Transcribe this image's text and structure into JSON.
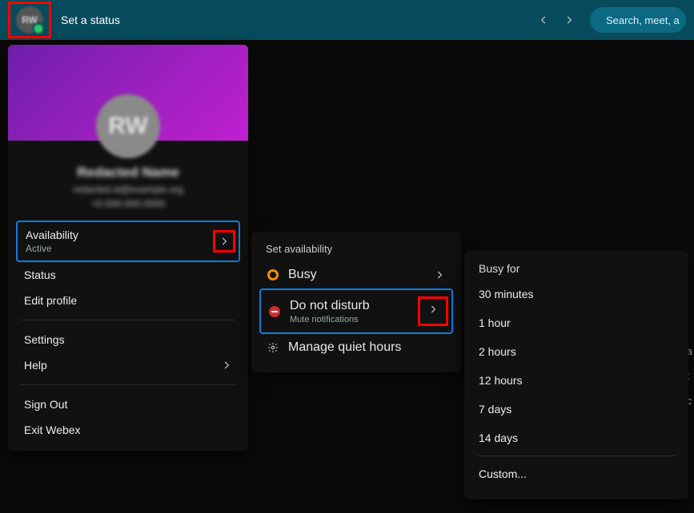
{
  "topbar": {
    "status_label": "Set a status",
    "search_placeholder": "Search, meet, a",
    "avatar_initials": "RW"
  },
  "profile": {
    "avatar_initials": "RW",
    "display_name": "Redacted Name",
    "email_line": "redacted.id@example.org",
    "phone_line": "+0-000-000-0000"
  },
  "menu": {
    "availability": {
      "label": "Availability",
      "value": "Active"
    },
    "status": {
      "label": "Status"
    },
    "edit_profile": {
      "label": "Edit profile"
    },
    "settings": {
      "label": "Settings"
    },
    "help": {
      "label": "Help"
    },
    "sign_out": {
      "label": "Sign Out"
    },
    "exit": {
      "label": "Exit Webex"
    }
  },
  "availability_panel": {
    "title": "Set availability",
    "busy": {
      "label": "Busy"
    },
    "dnd": {
      "label": "Do not disturb",
      "sub": "Mute notifications"
    },
    "quiet": {
      "label": "Manage quiet hours"
    }
  },
  "busy_panel": {
    "title": "Busy for",
    "options": [
      "30 minutes",
      "1 hour",
      "2 hours",
      "12 hours",
      "7 days",
      "14 days"
    ],
    "custom": "Custom..."
  },
  "edge_letters": [
    "a",
    "t",
    "c"
  ]
}
